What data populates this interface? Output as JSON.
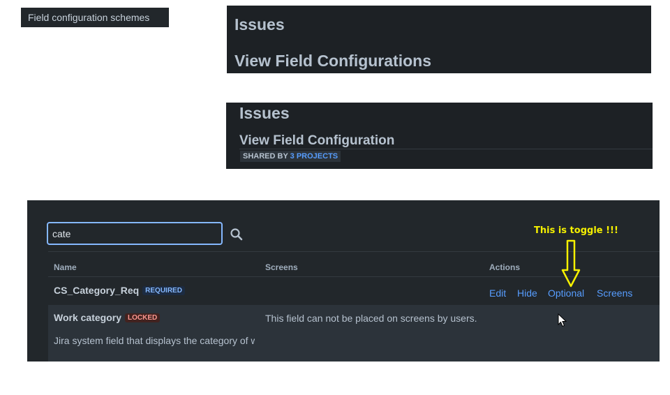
{
  "sidebar": {
    "item_label": "Field configuration schemes"
  },
  "panel_a": {
    "breadcrumb": "Issues",
    "title": "View Field Configurations"
  },
  "panel_b": {
    "breadcrumb": "Issues",
    "title": "View Field Configuration",
    "shared_prefix": "SHARED BY",
    "shared_link": "3 PROJECTS"
  },
  "search": {
    "value": "cate",
    "icon": "search-icon"
  },
  "table": {
    "headers": {
      "name": "Name",
      "screens": "Screens",
      "actions": "Actions"
    },
    "rows": [
      {
        "name": "CS_Category_Req",
        "lozenge": "REQUIRED",
        "actions": [
          "Edit",
          "Hide",
          "Optional",
          "Screens"
        ]
      },
      {
        "name": "Work category",
        "lozenge": "LOCKED",
        "screens_text": "This field can not be placed on screens by users.",
        "description": "Jira system field that displays the category of w"
      }
    ]
  },
  "annotation": {
    "text": "This is toggle !!!",
    "color": "#f5f000"
  },
  "colors": {
    "link": "#579dff",
    "panel_bg": "#22272b",
    "focus_border": "#85b8ff"
  }
}
